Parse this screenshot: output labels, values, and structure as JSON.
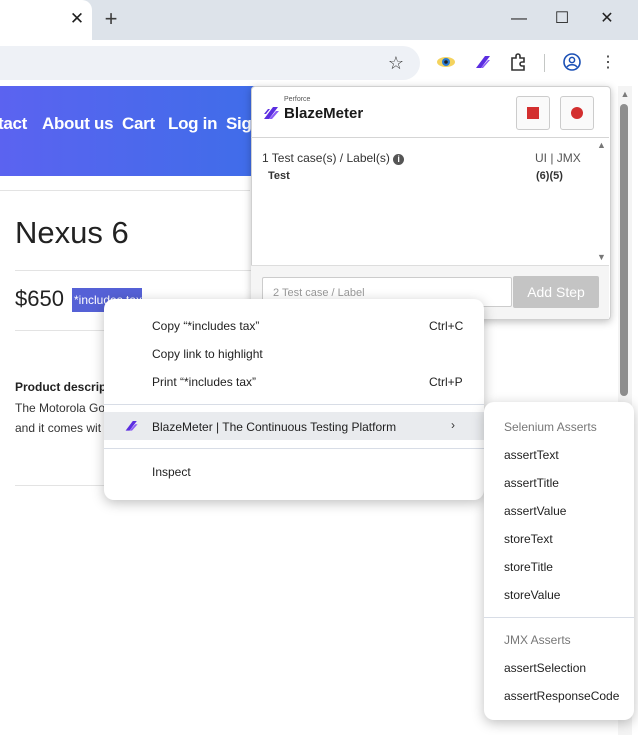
{
  "browser": {
    "tab_close": "✕",
    "new_tab": "+",
    "minimize": "—",
    "maximize": "☐",
    "close": "✕"
  },
  "nav": {
    "items": [
      "tact",
      "About us",
      "Cart",
      "Log in",
      "Sign"
    ]
  },
  "product": {
    "title": "Nexus 6",
    "price": "$650",
    "price_note": "*includes tax",
    "desc_heading": "Product descript",
    "desc_line1": "The Motorola Go",
    "desc_line2": "and it comes wit"
  },
  "popup": {
    "logo_small": "Perforce",
    "logo": "BlazeMeter",
    "test_cases": "1 Test case(s) / Label(s)",
    "format": "UI | JMX",
    "test_name": "Test",
    "test_count": "(6)(5)",
    "label_placeholder": "2 Test case / Label",
    "add_step": "Add Step"
  },
  "context_menu": {
    "copy": "Copy “*includes tax”",
    "copy_sc": "Ctrl+C",
    "copy_link": "Copy link to highlight",
    "print": "Print “*includes tax”",
    "print_sc": "Ctrl+P",
    "blazemeter": "BlazeMeter | The Continuous Testing Platform",
    "inspect": "Inspect"
  },
  "submenu": {
    "selenium_header": "Selenium Asserts",
    "selenium_items": [
      "assertText",
      "assertTitle",
      "assertValue",
      "storeText",
      "storeTitle",
      "storeValue"
    ],
    "jmx_header": "JMX Asserts",
    "jmx_items": [
      "assertSelection",
      "assertResponseCode"
    ]
  },
  "colors": {
    "accent": "#5561d6",
    "record": "#d32f2f",
    "nav": "#4b68ee"
  }
}
